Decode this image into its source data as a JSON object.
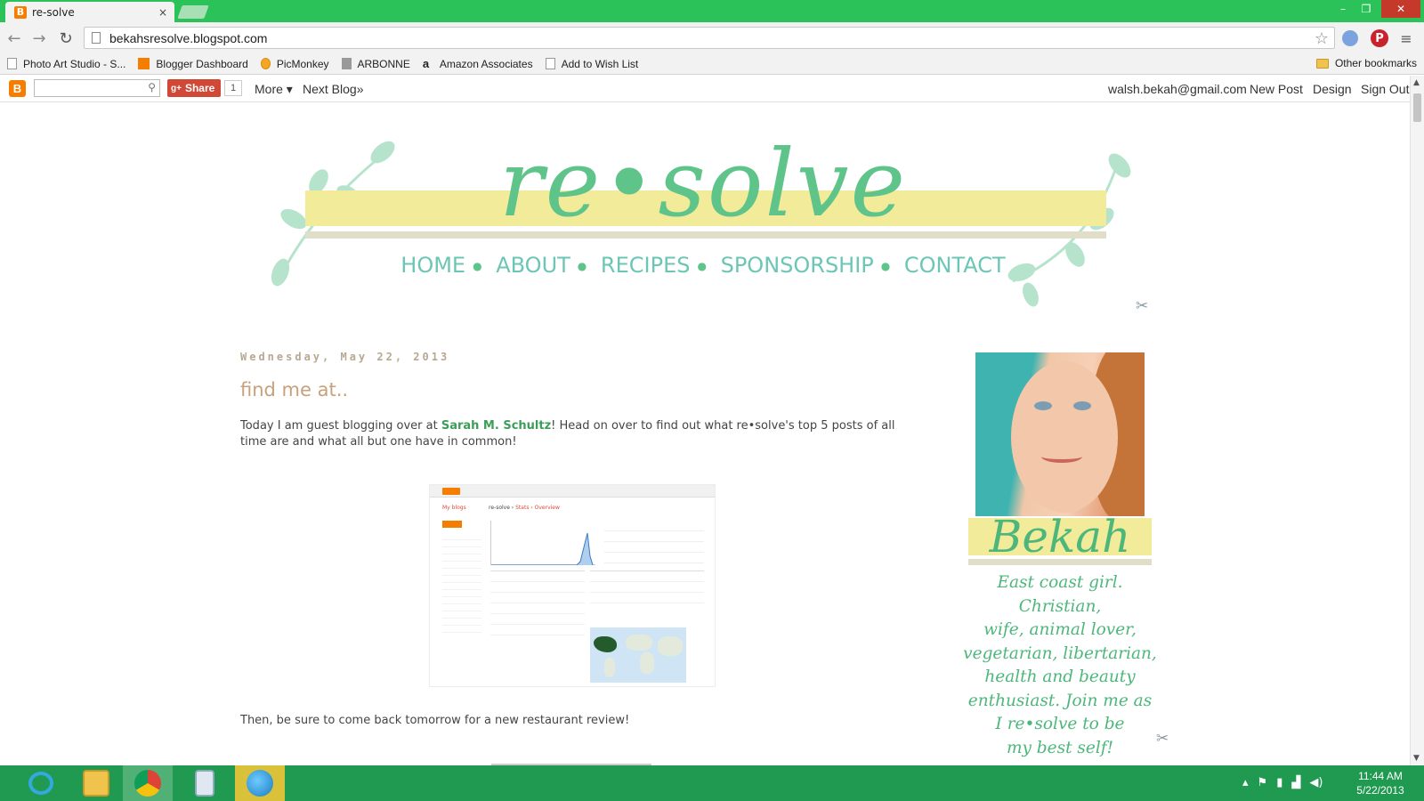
{
  "browser": {
    "tab_title": "re-solve",
    "tab_favicon": "blogger-icon",
    "close_tab_glyph": "×",
    "url": "bekahsresolve.blogspot.com",
    "window_controls": {
      "minimize": "–",
      "maximize": "❐",
      "close": "✕"
    }
  },
  "bookmarks": {
    "items": [
      {
        "label": "Photo Art Studio - S...",
        "icon": "page-icon"
      },
      {
        "label": "Blogger Dashboard",
        "icon": "blogger-icon"
      },
      {
        "label": "PicMonkey",
        "icon": "picmonkey-icon"
      },
      {
        "label": "ARBONNE",
        "icon": "arbonne-icon"
      },
      {
        "label": "Amazon Associates",
        "icon": "amazon-icon"
      },
      {
        "label": "Add to Wish List",
        "icon": "page-icon"
      }
    ],
    "other": "Other bookmarks"
  },
  "navbar": {
    "share_label": "Share",
    "share_count": "1",
    "more_label": "More ▾",
    "next_blog": "Next Blog»",
    "email": "walsh.bekah@gmail.com",
    "new_post": "New Post",
    "design": "Design",
    "sign_out": "Sign Out"
  },
  "blog": {
    "title": "re•solve",
    "menu": [
      "HOME",
      "ABOUT",
      "RECIPES",
      "SPONSORSHIP",
      "CONTACT"
    ],
    "menu_separator": "●",
    "accent_color": "#5ec48a",
    "band_color": "#f2eb9a"
  },
  "post": {
    "date": "Wednesday, May 22, 2013",
    "title": "find me at..",
    "body_before": "Today I am guest blogging over at ",
    "body_link": "Sarah M. Schultz",
    "body_after": "! Head on over to find out what re•solve's top 5 posts of all time are and what all but one have in common!",
    "outro": "Then, be sure to come back tomorrow for a new restaurant review!",
    "stats_image": {
      "my_blogs": "My blogs",
      "crumbs_blog": "re-solve › ",
      "crumbs_section": "Stats › Overview"
    }
  },
  "sidebar": {
    "profile_name": "Bekah",
    "bio_lines": [
      "East coast girl. Christian,",
      "wife, animal lover,",
      "vegetarian, libertarian,",
      "health and beauty",
      "enthusiast. Join me as",
      "I re•solve to be",
      "my best self!"
    ]
  },
  "taskbar": {
    "apps": [
      "internet-explorer-icon",
      "file-explorer-icon",
      "chrome-icon",
      "calculator-icon",
      "globe-icon"
    ],
    "time": "11:44 AM",
    "date": "5/22/2013"
  }
}
